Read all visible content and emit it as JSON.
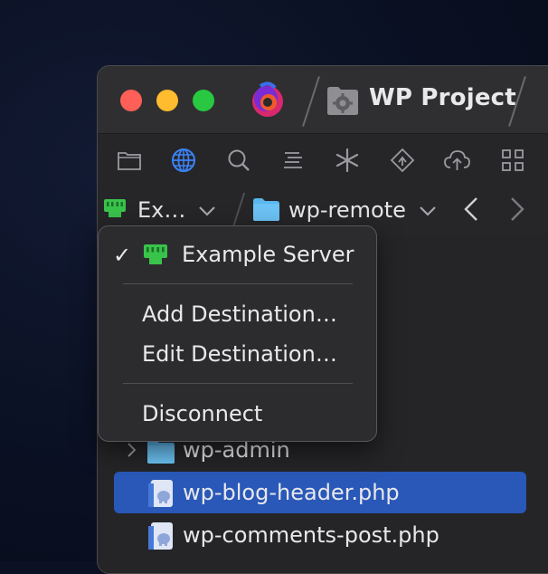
{
  "window": {
    "project_title": "WP Project",
    "app_icon": "app-logo-icon",
    "project_icon": "gear-folder-icon"
  },
  "toolbar": {
    "icons": [
      "folder-icon",
      "globe-icon",
      "search-icon",
      "list-icon",
      "asterisk-icon",
      "git-icon",
      "cloud-upload-icon",
      "grid-icon"
    ],
    "active_icon": "globe-icon",
    "active_color": "#3b82f6"
  },
  "pathbar": {
    "server_label": "Ex…",
    "folder_label": "wp-remote"
  },
  "dropdown": {
    "selected_server": "Example Server",
    "add_destination": "Add Destination…",
    "edit_destination": "Edit Destination…",
    "disconnect": "Disconnect"
  },
  "files": [
    {
      "name": "wp-admin",
      "type": "folder"
    },
    {
      "name": "wp-blog-header.php",
      "type": "php",
      "selected": true
    },
    {
      "name": "wp-comments-post.php",
      "type": "php"
    }
  ],
  "colors": {
    "selection": "#2958b8",
    "server_green": "#39c34a",
    "folder_blue": "#5ab7f0"
  }
}
